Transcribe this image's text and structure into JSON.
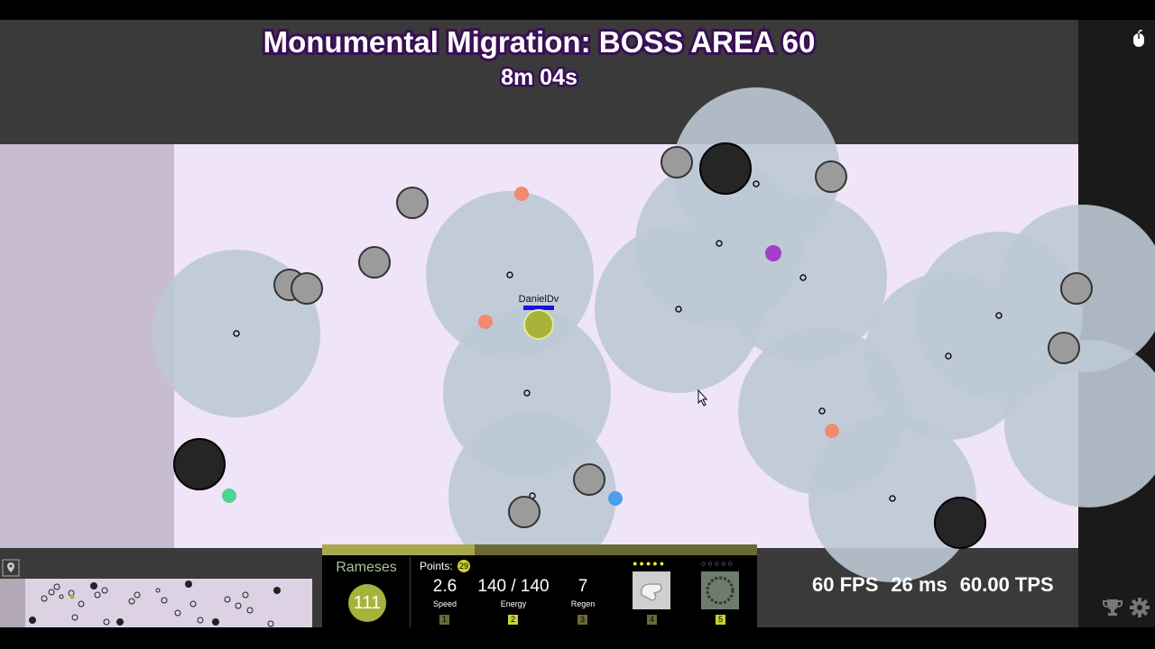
{
  "header": {
    "area_title": "Monumental Migration: BOSS AREA 60",
    "timer": "8m 04s"
  },
  "player": {
    "name": "DanielDv"
  },
  "hero": {
    "name": "Rameses",
    "level": "111",
    "xp_progress": 0.35,
    "points_label": "Points:",
    "points": "29",
    "stats": [
      {
        "value": "2.6",
        "label": "Speed",
        "key": "1"
      },
      {
        "value": "140 / 140",
        "label": "Energy",
        "key": "2"
      },
      {
        "value": "7",
        "label": "Regen",
        "key": "3"
      }
    ],
    "abilities": [
      {
        "key": "4",
        "upgrade_dots": "●●●●●",
        "icon": "bandage-icon"
      },
      {
        "key": "5",
        "upgrade_dots": "○○○○○",
        "icon": "ring-icon"
      }
    ]
  },
  "performance": {
    "fps": "60 FPS",
    "ping": "26 ms",
    "tps": "60.00 TPS"
  },
  "colors": {
    "arena": "#efe4f8",
    "safe_zone": "#c8bcd2",
    "aura": "#bdc9d4",
    "gray_enemy": "#9b9b9b",
    "dark_enemy": "#252525",
    "hero": "#a7b23a",
    "orange_enemy": "#f28a6e",
    "purple_enemy": "#a53cc8",
    "blue_enemy": "#4a9fea",
    "green_enemy": "#4fd390",
    "border": "#3a3a3a",
    "xp_bar": "#a7a84d"
  },
  "icons": [
    "mouse-icon",
    "map-pin-icon",
    "trophy-icon",
    "gear-icon",
    "cursor-icon"
  ]
}
